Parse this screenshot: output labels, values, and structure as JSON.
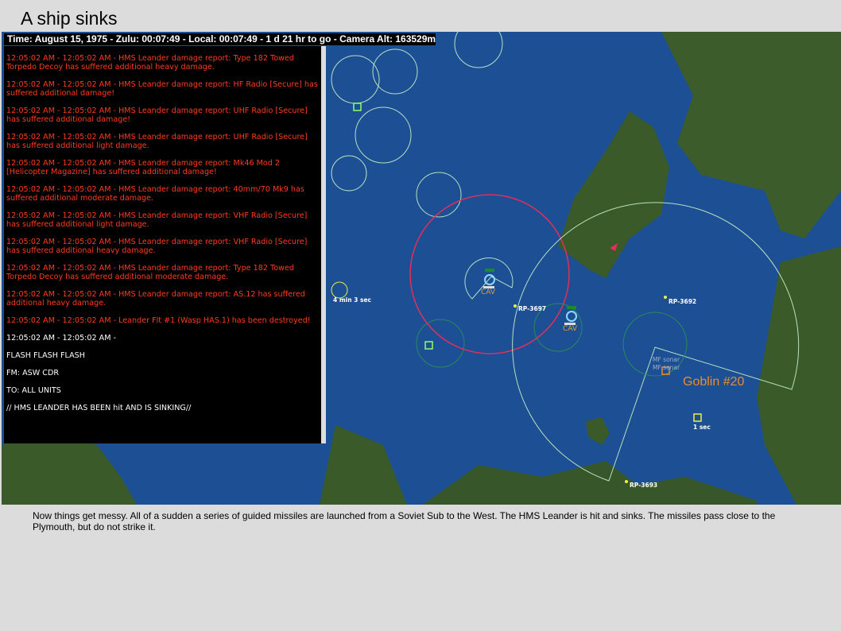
{
  "title": "A ship sinks",
  "status_bar": "Time: August 15, 1975 - Zulu: 00:07:49 - Local: 00:07:49 - 1 d 21 hr to go -  Camera Alt: 163529m",
  "log": [
    {
      "text": "12:05:02 AM - 12:05:02 AM - HMS Leander damage report: Type 182 Towed Torpedo Decoy has suffered additional heavy damage.",
      "color": "red"
    },
    {
      "text": "12:05:02 AM - 12:05:02 AM - HMS Leander damage report: HF Radio [Secure] has suffered additional damage!",
      "color": "red"
    },
    {
      "text": "12:05:02 AM - 12:05:02 AM - HMS Leander damage report: UHF Radio [Secure] has suffered additional damage!",
      "color": "red"
    },
    {
      "text": "12:05:02 AM - 12:05:02 AM - HMS Leander damage report: UHF Radio [Secure] has suffered additional light damage.",
      "color": "red"
    },
    {
      "text": "12:05:02 AM - 12:05:02 AM - HMS Leander damage report: Mk46 Mod 2 [Helicopter Magazine] has suffered additional damage!",
      "color": "red"
    },
    {
      "text": "12:05:02 AM - 12:05:02 AM - HMS Leander damage report: 40mm/70 Mk9 has suffered additional moderate damage.",
      "color": "red"
    },
    {
      "text": "12:05:02 AM - 12:05:02 AM - HMS Leander damage report: VHF Radio [Secure] has suffered additional light damage.",
      "color": "red"
    },
    {
      "text": "12:05:02 AM - 12:05:02 AM - HMS Leander damage report: VHF Radio [Secure] has suffered additional heavy damage.",
      "color": "red"
    },
    {
      "text": "12:05:02 AM - 12:05:02 AM - HMS Leander damage report: Type 182 Towed Torpedo Decoy has suffered additional moderate damage.",
      "color": "red"
    },
    {
      "text": "12:05:02 AM - 12:05:02 AM - HMS Leander damage report: AS.12 has suffered additional heavy damage.",
      "color": "red"
    },
    {
      "text": "12:05:02 AM - 12:05:02 AM - Leander Flt #1 (Wasp HAS.1) has been destroyed!",
      "color": "red"
    },
    {
      "text": "12:05:02 AM - 12:05:02 AM -",
      "color": "white"
    },
    {
      "text": "FLASH FLASH FLASH",
      "color": "white"
    },
    {
      "text": "FM: ASW CDR",
      "color": "white"
    },
    {
      "text": "TO: ALL UNITS",
      "color": "white"
    },
    {
      "text": "// HMS LEANDER HAS BEEN hit AND IS SINKING//",
      "color": "white"
    }
  ],
  "map": {
    "labels": {
      "rp3697": "RP-3697",
      "rp3692": "RP-3692",
      "rp3693": "RP-3693",
      "cav1": "CAV",
      "cav2": "CAV",
      "timer1": "4 min 3 sec",
      "timer2": "1 sec",
      "sonar1": "MF sonar",
      "sonar2": "MF sonar",
      "goblin": "Goblin #20"
    },
    "colors": {
      "sea": "#1c4f94",
      "land": "#3a5a2a",
      "range": "#b8e0c0",
      "threat": "#e0305a",
      "contact": "#f08a2a",
      "refpoint": "#f0f040"
    }
  },
  "caption": "Now things get messy.  All of a sudden a series of guided missiles are launched from a Soviet Sub to the West.  The HMS Leander is hit and sinks.  The missiles pass close to the Plymouth, but do not strike it."
}
